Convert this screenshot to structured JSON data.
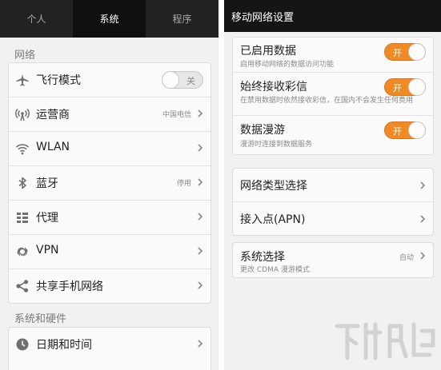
{
  "left": {
    "tabs": [
      {
        "label": "个人",
        "active": false
      },
      {
        "label": "系统",
        "active": true
      },
      {
        "label": "程序",
        "active": false
      }
    ],
    "network_section_title": "网络",
    "network_items": {
      "airplane": {
        "label": "飞行模式",
        "icon": "airplane-icon",
        "toggle": "关"
      },
      "carrier": {
        "label": "运营商",
        "icon": "signal-tower-icon",
        "value": "中国电信"
      },
      "wlan": {
        "label": "WLAN",
        "icon": "wifi-icon"
      },
      "bluetooth": {
        "label": "蓝牙",
        "icon": "bluetooth-icon",
        "value": "停用"
      },
      "proxy": {
        "label": "代理",
        "icon": "proxy-icon"
      },
      "vpn": {
        "label": "VPN",
        "icon": "vpn-icon"
      },
      "tether": {
        "label": "共享手机网络",
        "icon": "share-icon"
      }
    },
    "hardware_section_title": "系统和硬件",
    "hardware_items": {
      "datetime": {
        "label": "日期和时间",
        "icon": "clock-icon"
      }
    }
  },
  "right": {
    "title": "移动网络设置",
    "toggles": {
      "data": {
        "label": "已启用数据",
        "sub": "启用移动网络的数据访问功能",
        "state": "开"
      },
      "mms": {
        "label": "始终接收彩信",
        "sub": "在禁用数据时依然接收彩信，在国内不会发生任何费用",
        "state": "开"
      },
      "roaming": {
        "label": "数据漫游",
        "sub": "漫游时连接到数据服务",
        "state": "开"
      }
    },
    "network_type": {
      "label": "网络类型选择"
    },
    "apn": {
      "label": "接入点(APN)"
    },
    "system_select": {
      "label": "系统选择",
      "sub": "更改 CDMA 漫游模式",
      "value": "自动"
    }
  },
  "colors": {
    "accent": "#f08a24",
    "tab_bar": "#222222",
    "header": "#151515"
  }
}
